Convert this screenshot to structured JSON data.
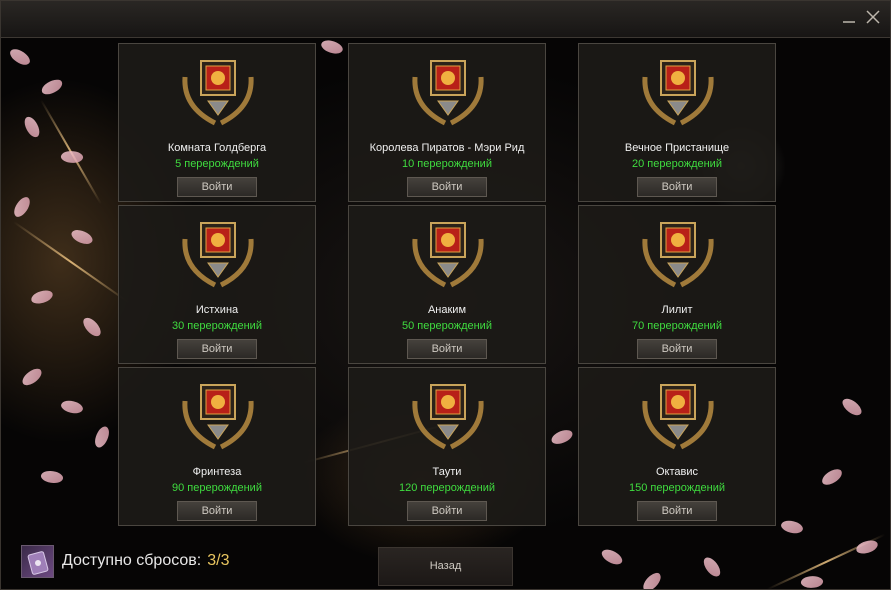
{
  "window": {
    "minimize_icon": "minimize-icon",
    "close_icon": "close-icon"
  },
  "rooms": [
    {
      "name": "Комната Голдберга",
      "requirement": "5 перерождений",
      "button": "Войти"
    },
    {
      "name": "Королева Пиратов - Мэри Рид",
      "requirement": "10 перерождений",
      "button": "Войти"
    },
    {
      "name": "Вечное Пристанище",
      "requirement": "20 перерождений",
      "button": "Войти"
    },
    {
      "name": "Истхина",
      "requirement": "30 перерождений",
      "button": "Войти"
    },
    {
      "name": "Анаким",
      "requirement": "50 перерождений",
      "button": "Войти"
    },
    {
      "name": "Лилит",
      "requirement": "70 перерождений",
      "button": "Войти"
    },
    {
      "name": "Фринтеза",
      "requirement": "90 перерождений",
      "button": "Войти"
    },
    {
      "name": "Таути",
      "requirement": "120 перерождений",
      "button": "Войти"
    },
    {
      "name": "Октавис",
      "requirement": "150 перерождений",
      "button": "Войти"
    }
  ],
  "footer": {
    "resets_label": "Доступно сбросов:",
    "resets_count": "3/3",
    "back_button": "Назад",
    "reset_icon": "scroll-icon"
  },
  "colors": {
    "requirement_green": "#3fdc3f",
    "count_gold": "#e8c560"
  }
}
